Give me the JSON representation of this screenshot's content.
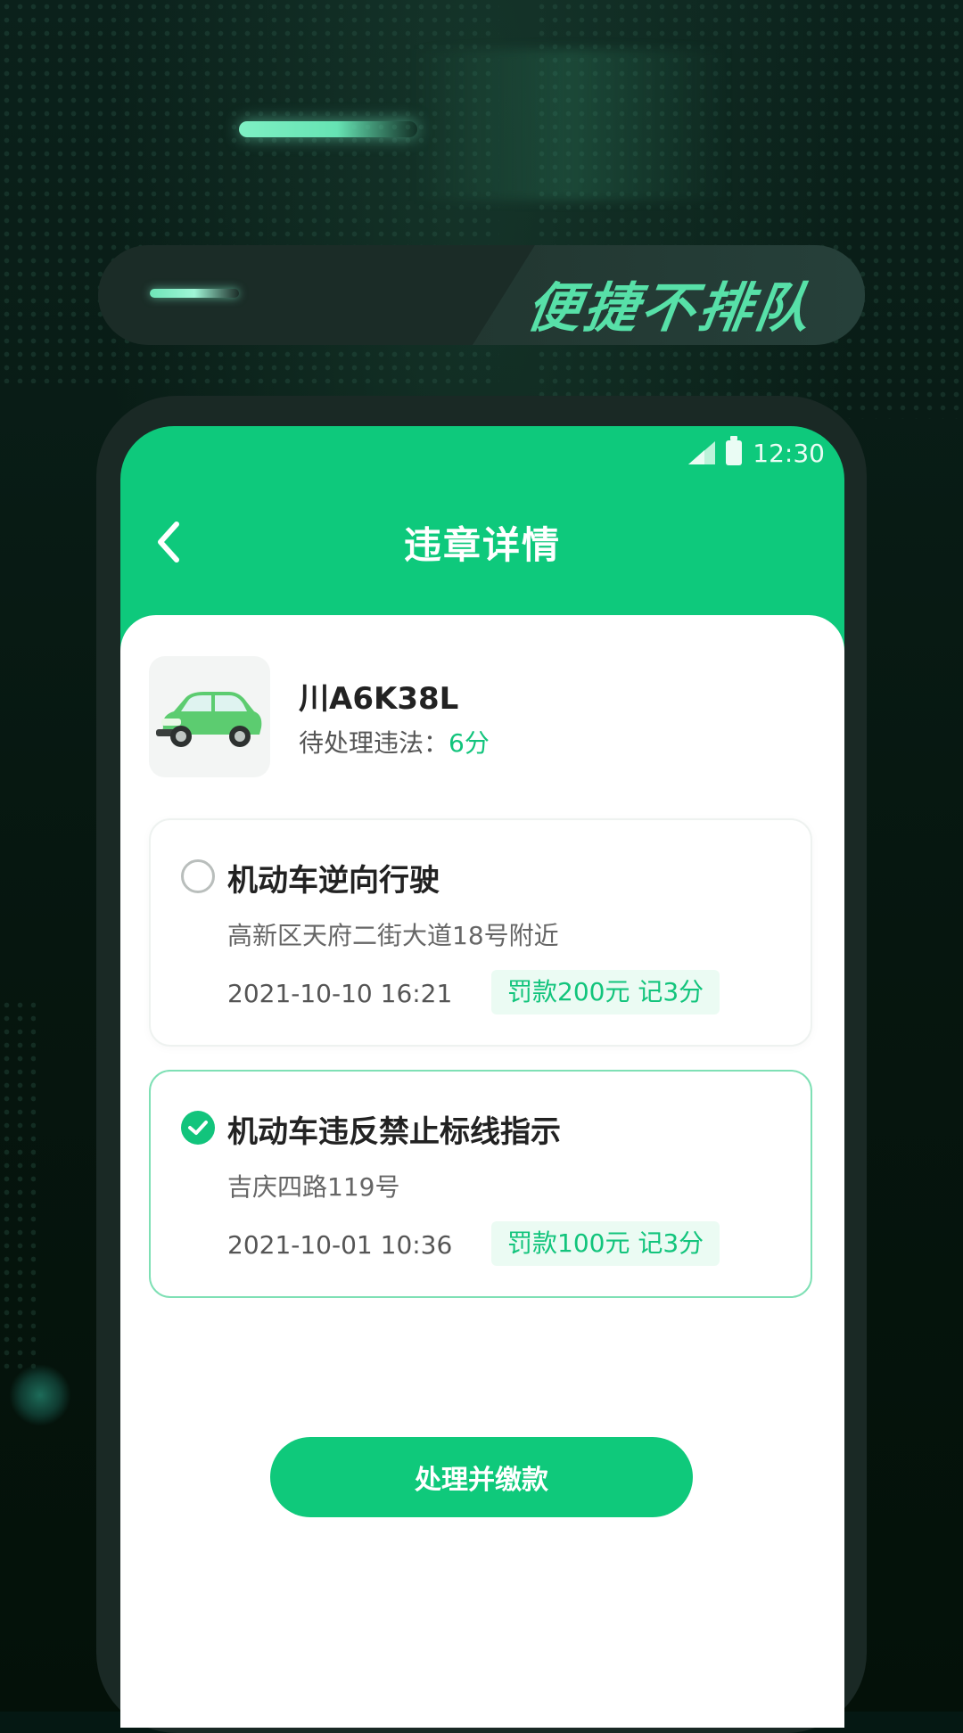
{
  "banner": {
    "slogan": "便捷不排队"
  },
  "status_bar": {
    "time": "12:30",
    "icons": [
      "signal-icon",
      "battery-icon"
    ]
  },
  "nav": {
    "title": "违章详情",
    "back_icon": "chevron-left-icon"
  },
  "vehicle": {
    "plate": "川A6K38L",
    "pending_label": "待处理违法：",
    "pending_points": "6分",
    "image_icon": "car-icon"
  },
  "violations": [
    {
      "title": "机动车逆向行驶",
      "address": "高新区天府二街大道18号附近",
      "time": "2021-10-10 16:21",
      "fine": "罚款200元 记3分",
      "selected": false
    },
    {
      "title": "机动车违反禁止标线指示",
      "address": "吉庆四路119号",
      "time": "2021-10-01 10:36",
      "fine": "罚款100元 记3分",
      "selected": true
    }
  ],
  "action": {
    "pay_label": "处理并缴款"
  },
  "colors": {
    "accent": "#0fc97b",
    "background": "#051813",
    "slogan": "#57e0a8"
  }
}
